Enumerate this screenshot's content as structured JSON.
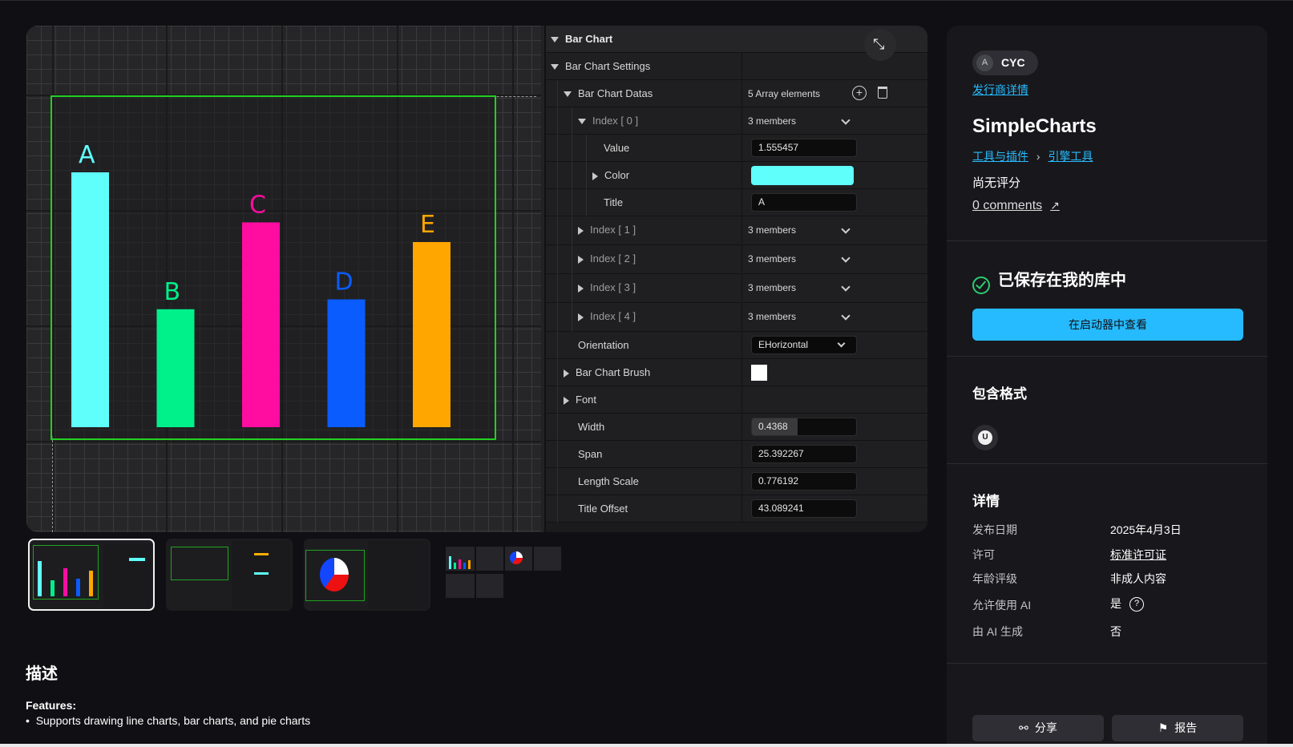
{
  "viewer": {
    "chart_data": {
      "type": "bar",
      "categories": [
        "A",
        "B",
        "C",
        "D",
        "E"
      ],
      "values": [
        1.555457,
        0.72,
        1.25,
        0.78,
        1.13
      ],
      "colors": [
        "#5ffffc",
        "#00f08a",
        "#ff0ca0",
        "#0a5cff",
        "#ffa600"
      ],
      "title": "",
      "xlabel": "",
      "ylabel": "",
      "ylim": [
        0,
        1.555457
      ]
    },
    "panel": {
      "rows": [
        {
          "name": "Bar Chart",
          "value": ""
        },
        {
          "name": "Bar Chart Settings",
          "value": ""
        },
        {
          "name": "Bar Chart Datas",
          "value": "5 Array elements"
        },
        {
          "name": "Index [ 0 ]",
          "value": "3 members"
        },
        {
          "name": "Value",
          "value": "1.555457"
        },
        {
          "name": "Color",
          "value": "#5ffffc"
        },
        {
          "name": "Title",
          "value": "A"
        },
        {
          "name": "Index [ 1 ]",
          "value": "3 members"
        },
        {
          "name": "Index [ 2 ]",
          "value": "3 members"
        },
        {
          "name": "Index [ 3 ]",
          "value": "3 members"
        },
        {
          "name": "Index [ 4 ]",
          "value": "3 members"
        },
        {
          "name": "Orientation",
          "value": "EHorizontal"
        },
        {
          "name": "Bar Chart Brush",
          "value": "#ffffff"
        },
        {
          "name": "Font",
          "value": ""
        },
        {
          "name": "Width",
          "value": "0.4368"
        },
        {
          "name": "Span",
          "value": "25.392267"
        },
        {
          "name": "Length Scale",
          "value": "0.776192"
        },
        {
          "name": "Title Offset",
          "value": "43.089241"
        }
      ],
      "width_fraction": 0.4368
    },
    "expand_icon": "expand-arrows-icon"
  },
  "thumbnails": [
    "Bar chart settings",
    "Line chart settings",
    "Pie chart settings",
    "Charts overview"
  ],
  "description": {
    "heading": "描述",
    "features_label": "Features:",
    "features": [
      "Supports drawing line charts, bar charts, and pie charts"
    ]
  },
  "sidebar": {
    "publisher": {
      "avatar": "A",
      "name": "CYC",
      "link": "发行商详情"
    },
    "product_title": "SimpleCharts",
    "categories": [
      "工具与插件",
      "引擎工具"
    ],
    "rating": "尚无评分",
    "comments": "0 comments",
    "saved_label": "已保存在我的库中",
    "open_launcher": "在启动器中查看",
    "formats_heading": "包含格式",
    "format_icon": "unreal-engine-icon",
    "details_heading": "详情",
    "details": [
      {
        "label": "发布日期",
        "value": "2025年4月3日"
      },
      {
        "label": "许可",
        "value": "标准许可证"
      },
      {
        "label": "年龄评级",
        "value": "非成人内容"
      },
      {
        "label": "允许使用 AI",
        "value": "是"
      },
      {
        "label": "由 AI 生成",
        "value": "否"
      }
    ],
    "share": "分享",
    "report": "报告",
    "accent_color": "#26bbff",
    "saved_color": "#2ecc71"
  }
}
